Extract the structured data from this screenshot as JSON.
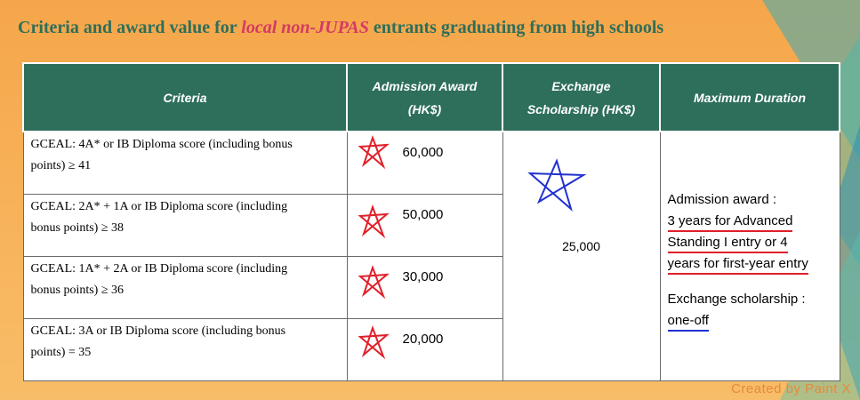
{
  "title": {
    "prefix": "Criteria and award value for ",
    "emphasis": "local non-JUPAS",
    "suffix": " entrants graduating from high schools"
  },
  "table": {
    "headers": {
      "criteria": "Criteria",
      "admission_line1": "Admission Award",
      "admission_line2": "(HK$)",
      "exchange_line1": "Exchange",
      "exchange_line2": "Scholarship (HK$)",
      "duration": "Maximum Duration"
    },
    "rows": [
      {
        "criteria_line1": "GCEAL:  4A* or IB Diploma score (including bonus",
        "criteria_line2": "points) ≥ 41",
        "award": "60,000"
      },
      {
        "criteria_line1": "GCEAL:  2A* + 1A or IB Diploma score (including",
        "criteria_line2": "bonus points) ≥ 38",
        "award": "50,000"
      },
      {
        "criteria_line1": "GCEAL:  1A* + 2A or IB Diploma score (including",
        "criteria_line2": "bonus points) ≥ 36",
        "award": "30,000"
      },
      {
        "criteria_line1": "GCEAL:  3A or IB Diploma score (including bonus",
        "criteria_line2": "points) = 35",
        "award": "20,000"
      }
    ],
    "exchange_value": "25,000",
    "duration": {
      "line1": "Admission award :",
      "line2": "3 years for Advanced",
      "line3": "Standing I entry or 4",
      "line4": "years for first-year entry",
      "line5": "Exchange scholarship :",
      "line6": "one-off"
    }
  },
  "watermark": "Created by Paint X",
  "colors": {
    "header_bg": "#2e6f5c",
    "title": "#2f6e5a",
    "title_emphasis": "#d23a66",
    "annotation_red": "#e0202a",
    "annotation_blue": "#2030d0"
  }
}
